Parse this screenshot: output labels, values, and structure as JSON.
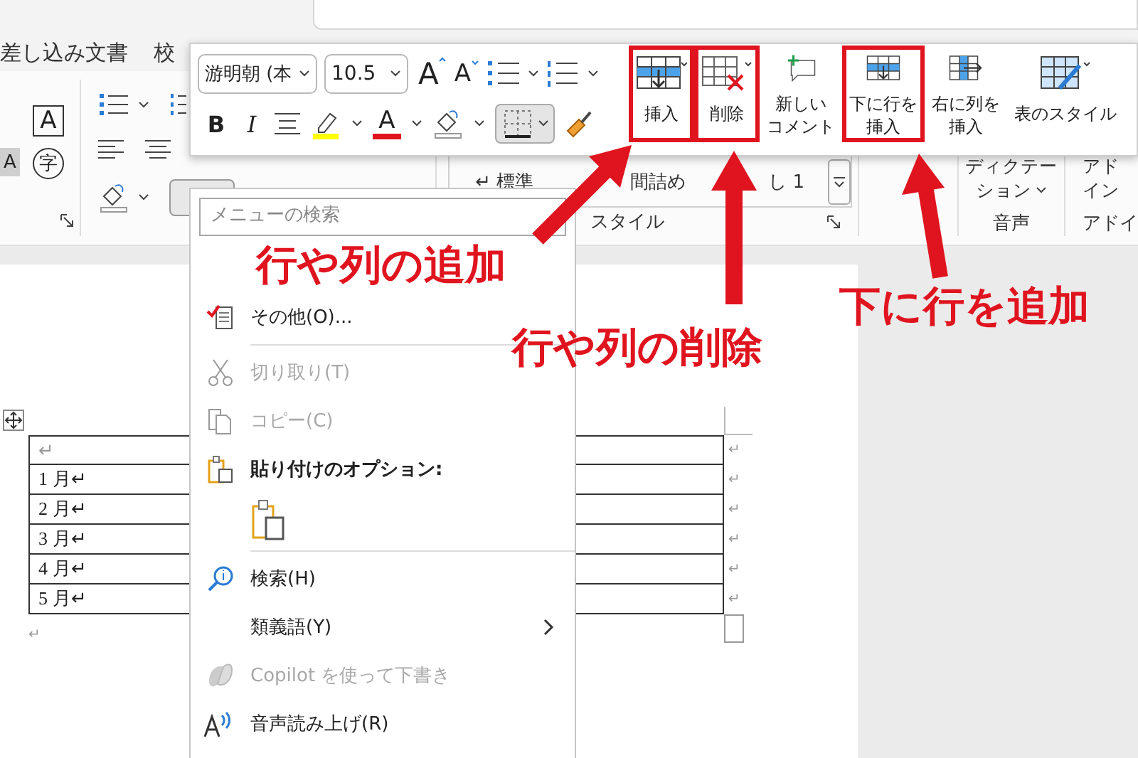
{
  "ribbon_tabs": [
    {
      "label": "差し込み文書"
    },
    {
      "label": "校"
    }
  ],
  "ribbon": {
    "char_buttons": [
      {
        "text": "A",
        "kind": "boxed"
      },
      {
        "text": "A",
        "kind": "highlighted"
      },
      {
        "text": "字",
        "kind": "circled"
      }
    ],
    "styles": [
      {
        "mark": "↵",
        "name": "標準"
      },
      {
        "name": "間詰め"
      },
      {
        "name": "し 1"
      }
    ],
    "styles_label": "スタイル",
    "voice": {
      "button_lines": [
        "ディクテー",
        "ション"
      ],
      "label": "音声"
    },
    "addins": {
      "button_lines": [
        "アド",
        "イン"
      ],
      "label": "アドイ"
    }
  },
  "mini_toolbar": {
    "font": "游明朝 (本",
    "size": "10.5",
    "grow": "A",
    "shrink": "A",
    "bold": "B",
    "italic": "I",
    "font_color": "A",
    "big_buttons": [
      {
        "label_lines": [
          "挿入"
        ],
        "highlighted": true
      },
      {
        "label_lines": [
          "削除"
        ],
        "highlighted": true
      },
      {
        "label_lines": [
          "新しい",
          "コメント"
        ],
        "highlighted": false
      },
      {
        "label_lines": [
          "下に行を",
          "挿入"
        ],
        "highlighted": true
      },
      {
        "label_lines": [
          "右に列を",
          "挿入"
        ],
        "highlighted": false
      },
      {
        "label_lines": [
          "表のスタイル"
        ],
        "highlighted": false
      }
    ]
  },
  "context_menu": {
    "search_placeholder": "メニューの検索",
    "items": [
      {
        "kind": "item",
        "label": "その他(O)...",
        "disabled": false
      },
      {
        "kind": "separator"
      },
      {
        "kind": "item",
        "label": "切り取り(T)",
        "disabled": true
      },
      {
        "kind": "item",
        "label": "コピー(C)",
        "disabled": true
      },
      {
        "kind": "header",
        "label": "貼り付けのオプション:"
      },
      {
        "kind": "paste"
      },
      {
        "kind": "separator"
      },
      {
        "kind": "item",
        "label": "検索(H)",
        "disabled": false
      },
      {
        "kind": "submenu",
        "label": "類義語(Y)",
        "disabled": false
      },
      {
        "kind": "item",
        "label": "Copilot を使って下書き",
        "disabled": true
      },
      {
        "kind": "item",
        "label": "音声読み上げ(R)",
        "disabled": false
      }
    ]
  },
  "document": {
    "table_rows": [
      {
        "cell": "↵",
        "end": "↵"
      },
      {
        "cell": "1 月↵",
        "end": "↵"
      },
      {
        "cell": "2 月↵",
        "end": "↵"
      },
      {
        "cell": "3 月↵",
        "end": "↵"
      },
      {
        "cell": "4 月↵",
        "end": "↵"
      },
      {
        "cell": "5 月↵",
        "end": "↵"
      }
    ],
    "after_table": "↵"
  },
  "annotations": [
    {
      "text": "行や列の追加"
    },
    {
      "text": "行や列の削除"
    },
    {
      "text": "下に行を追加"
    }
  ]
}
